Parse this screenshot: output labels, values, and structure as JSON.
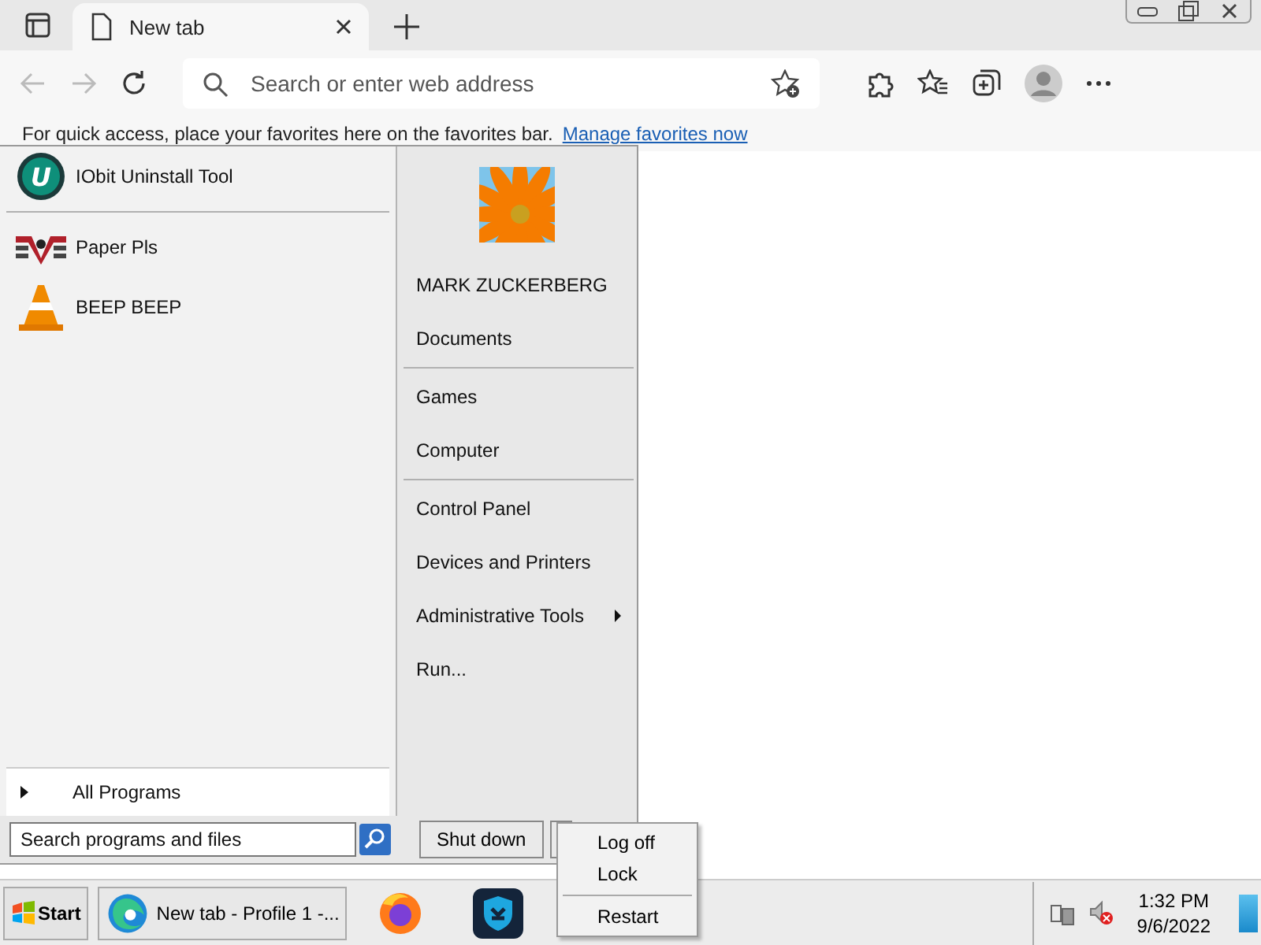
{
  "browser": {
    "tab": {
      "title": "New tab"
    },
    "address_bar": {
      "placeholder": "Search or enter web address"
    },
    "favorites_bar": {
      "message": "For quick access, place your favorites here on the favorites bar.",
      "link": "Manage favorites now"
    }
  },
  "start_menu": {
    "pinned": [
      {
        "label": "IObit Uninstall Tool",
        "kind": "iobit",
        "icon_letter": "U"
      }
    ],
    "recent": [
      {
        "label": "Paper Pls",
        "kind": "eagle"
      },
      {
        "label": "BEEP BEEP",
        "kind": "cone"
      }
    ],
    "all_programs": "All Programs",
    "search": {
      "placeholder": "Search programs and files"
    },
    "place_groups": [
      [
        {
          "label": "MARK ZUCKERBERG",
          "submenu": false
        },
        {
          "label": "Documents",
          "submenu": false
        }
      ],
      [
        {
          "label": "Games",
          "submenu": false
        },
        {
          "label": "Computer",
          "submenu": false
        }
      ],
      [
        {
          "label": "Control Panel",
          "submenu": false
        },
        {
          "label": "Devices and Printers",
          "submenu": false
        },
        {
          "label": "Administrative Tools",
          "submenu": true
        },
        {
          "label": "Run...",
          "submenu": false
        }
      ]
    ],
    "shutdown": "Shut down"
  },
  "power_menu": {
    "groups": [
      [
        "Log off",
        "Lock"
      ],
      [
        "Restart"
      ]
    ]
  },
  "taskbar": {
    "start": "Start",
    "buttons": [
      {
        "kind": "edge",
        "label": "New tab - Profile 1 -..."
      },
      {
        "kind": "firefox"
      },
      {
        "kind": "shield"
      }
    ],
    "time": "1:32 PM",
    "date": "9/6/2022"
  }
}
